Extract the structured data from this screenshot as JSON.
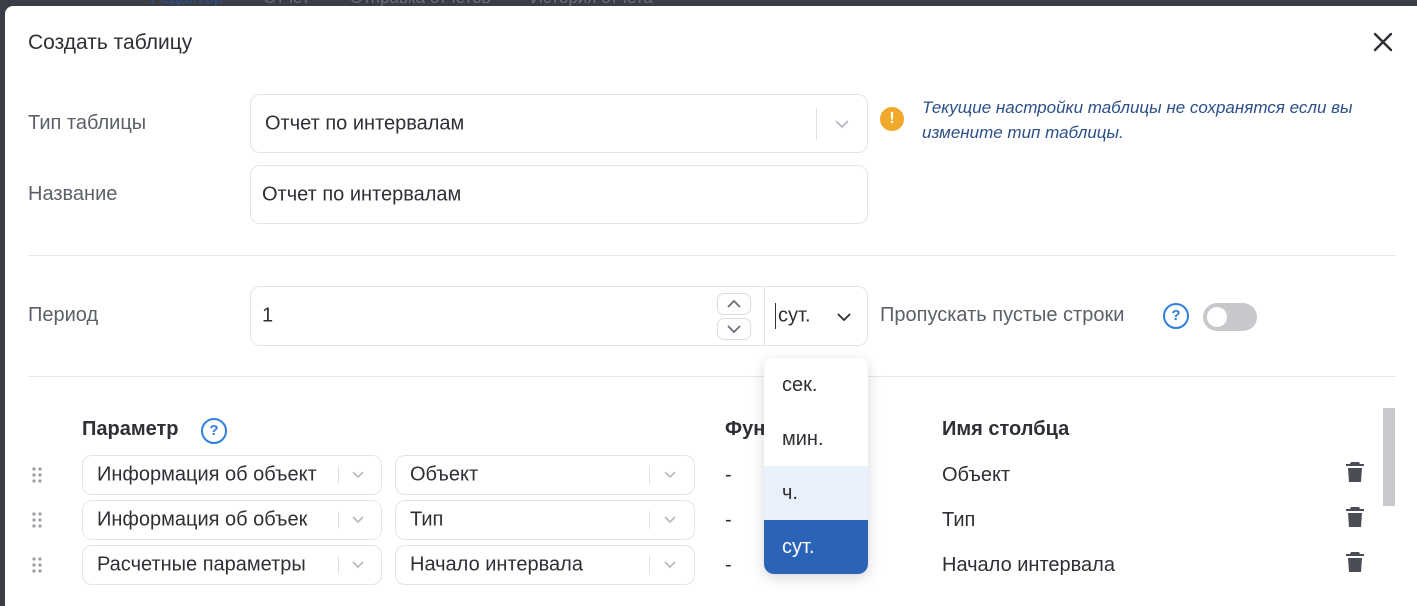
{
  "dialog": {
    "title": "Создать таблицу",
    "background_tabs": [
      "Редактор",
      "Отчет",
      "Отправка отчетов",
      "История отчета"
    ]
  },
  "form": {
    "table_type_label": "Тип таблицы",
    "table_type_value": "Отчет по интервалам",
    "warning_text": "Текущие настройки таблицы не сохранятся если вы измените тип таблицы.",
    "name_label": "Название",
    "name_value": "Отчет по интервалам",
    "period_label": "Период",
    "period_value": "1",
    "period_unit": "сут.",
    "skip_empty_label": "Пропускать пустые строки",
    "skip_empty_enabled": false
  },
  "unit_dropdown": {
    "options": [
      "сек.",
      "мин.",
      "ч.",
      "сут."
    ],
    "hovered": "ч.",
    "selected": "сут."
  },
  "columns_table": {
    "headers": {
      "parameter": "Параметр",
      "function": "Фун",
      "column_name": "Имя столбца"
    },
    "rows": [
      {
        "source": "Информация об объект",
        "param": "Объект",
        "function": "-",
        "column_name": "Объект"
      },
      {
        "source": "Информация об объек",
        "param": "Тип",
        "function": "-",
        "column_name": "Тип"
      },
      {
        "source": "Расчетные параметры",
        "param": "Начало интервала",
        "function": "-",
        "column_name": "Начало интервала"
      }
    ]
  },
  "colors": {
    "accent": "#2b63b6",
    "warning": "#f0a92a",
    "help": "#2f7fdc"
  }
}
